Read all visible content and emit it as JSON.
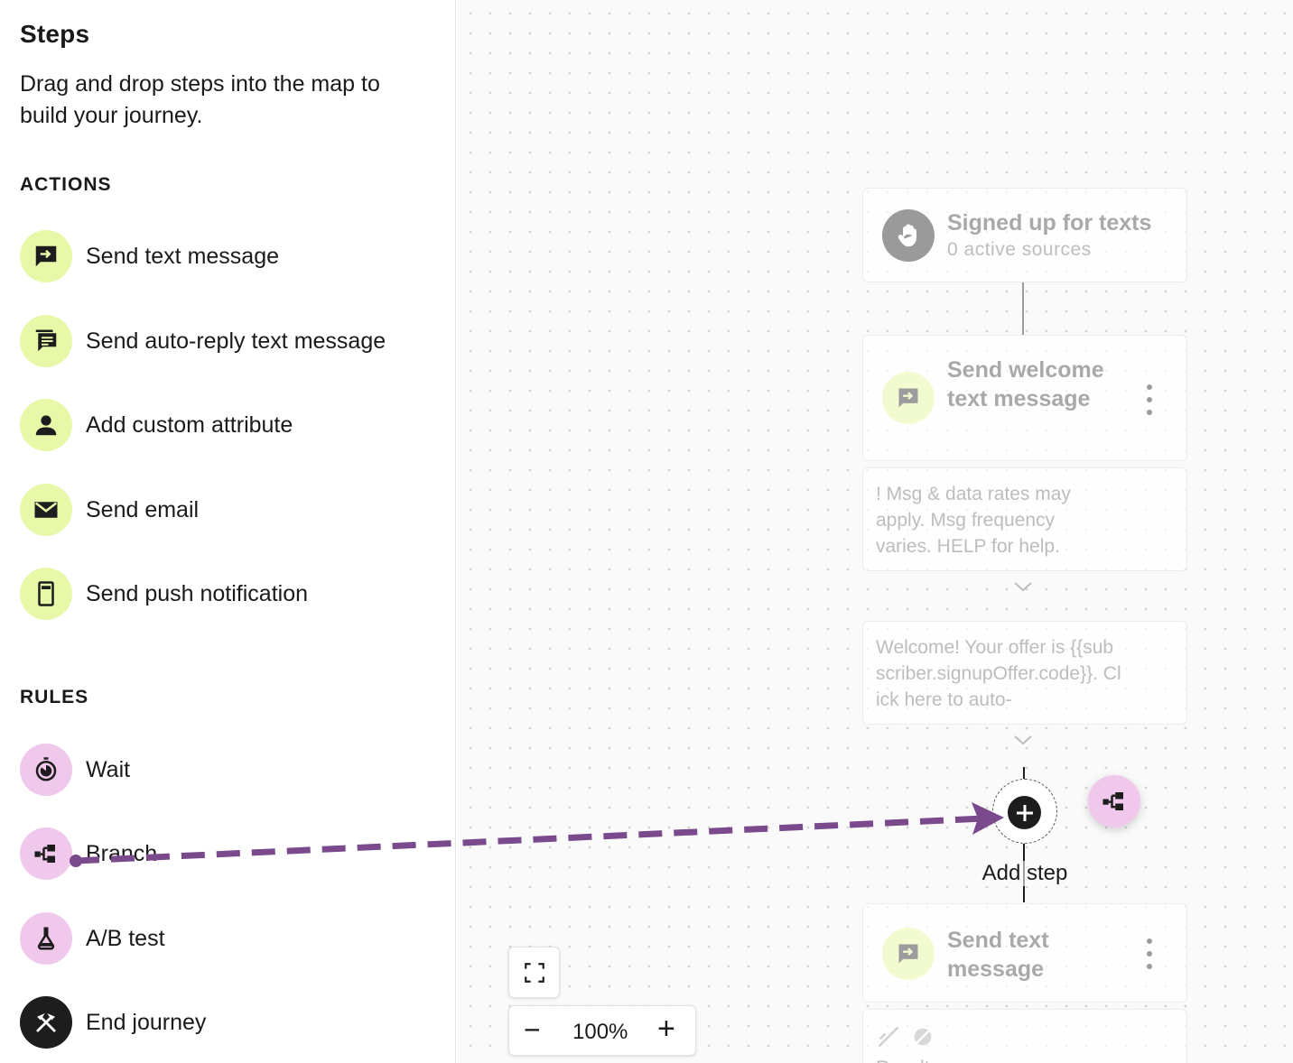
{
  "sidebar": {
    "title": "Steps",
    "description": "Drag and drop steps into the map to build your journey.",
    "actions_label": "ACTIONS",
    "actions": [
      {
        "label": "Send text message",
        "icon": "message-forward-icon"
      },
      {
        "label": "Send auto-reply text message",
        "icon": "auto-reply-message-icon"
      },
      {
        "label": "Add custom attribute",
        "icon": "person-icon"
      },
      {
        "label": "Send email",
        "icon": "envelope-icon"
      },
      {
        "label": "Send push notification",
        "icon": "phone-icon"
      }
    ],
    "rules_label": "RULES",
    "rules": [
      {
        "label": "Wait",
        "icon": "stopwatch-icon"
      },
      {
        "label": "Branch",
        "icon": "branch-icon"
      },
      {
        "label": "A/B test",
        "icon": "flask-icon"
      },
      {
        "label": "End journey",
        "icon": "end-journey-icon"
      }
    ]
  },
  "canvas": {
    "trigger": {
      "title": "Signed up for texts",
      "subtitle": "0 active sources",
      "icon": "hand-icon"
    },
    "welcome_step": {
      "title": "Send welcome text message",
      "icon": "message-forward-icon"
    },
    "welcome_preview_1": "! Msg & data rates may apply. Msg frequency varies. HELP for help.",
    "welcome_preview_2": "Welcome! Your offer is {{subscriber.signupOffer.code}}. Click here to auto-",
    "add_step_label": "Add step",
    "dragging_step_icon": "branch-icon",
    "next_step": {
      "title": "Send text message",
      "icon": "message-forward-icon"
    },
    "next_preview_text": "Result ..."
  },
  "zoom": {
    "level": "100%",
    "minus": "−",
    "plus": "+"
  },
  "colors": {
    "action_icon_bg": "#e7f9a9",
    "rule_icon_bg": "#efc8ec",
    "end_icon_bg": "#1d1d1d",
    "drag_arrow": "#7a4a8c"
  }
}
